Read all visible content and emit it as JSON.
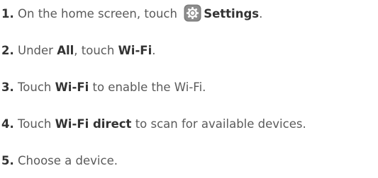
{
  "steps": [
    {
      "number": "1.",
      "text_before": "On the home screen, touch",
      "icon": "settings-gear-icon",
      "bold": "Settings",
      "text_after": "."
    },
    {
      "number": "2.",
      "text_a": "Under",
      "bold_a": "All",
      "text_b": ", touch",
      "bold_b": "Wi-Fi",
      "text_after": "."
    },
    {
      "number": "3.",
      "text_before": "Touch",
      "bold": "Wi-Fi",
      "text_after": "to enable the Wi-Fi."
    },
    {
      "number": "4.",
      "text_before": "Touch",
      "bold": "Wi-Fi direct",
      "text_after": "to scan for available devices."
    },
    {
      "number": "5.",
      "text": "Choose a device."
    }
  ],
  "colors": {
    "text": "#5a5a5a",
    "emphasis": "#333333",
    "icon_background": "#7d7d7d"
  }
}
